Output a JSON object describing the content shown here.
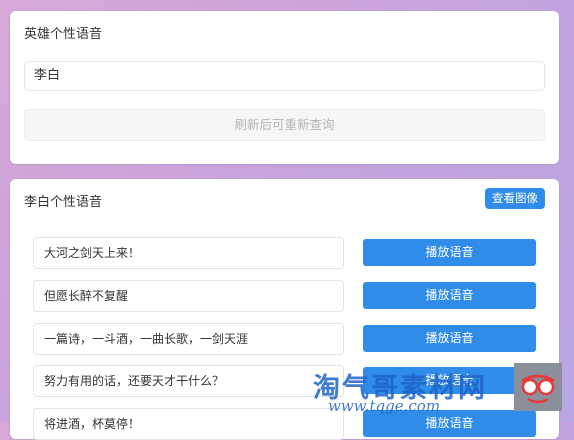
{
  "search_card": {
    "title": "英雄个性语音",
    "input_value": "李白",
    "refresh_label": "刷新后可重新查询"
  },
  "result_card": {
    "title": "李白个性语音",
    "view_image_label": "查看图像",
    "play_label": "播放语音",
    "quotes": [
      "大河之剑天上来！",
      "但愿长醉不复醒",
      "一篇诗，一斗酒，一曲长歌，一剑天涯",
      "努力有用的话，还要天才干什么？",
      "将进酒，杯莫停！"
    ]
  },
  "watermark": {
    "text": "淘气哥素材网",
    "url": "www.tqge.com"
  }
}
